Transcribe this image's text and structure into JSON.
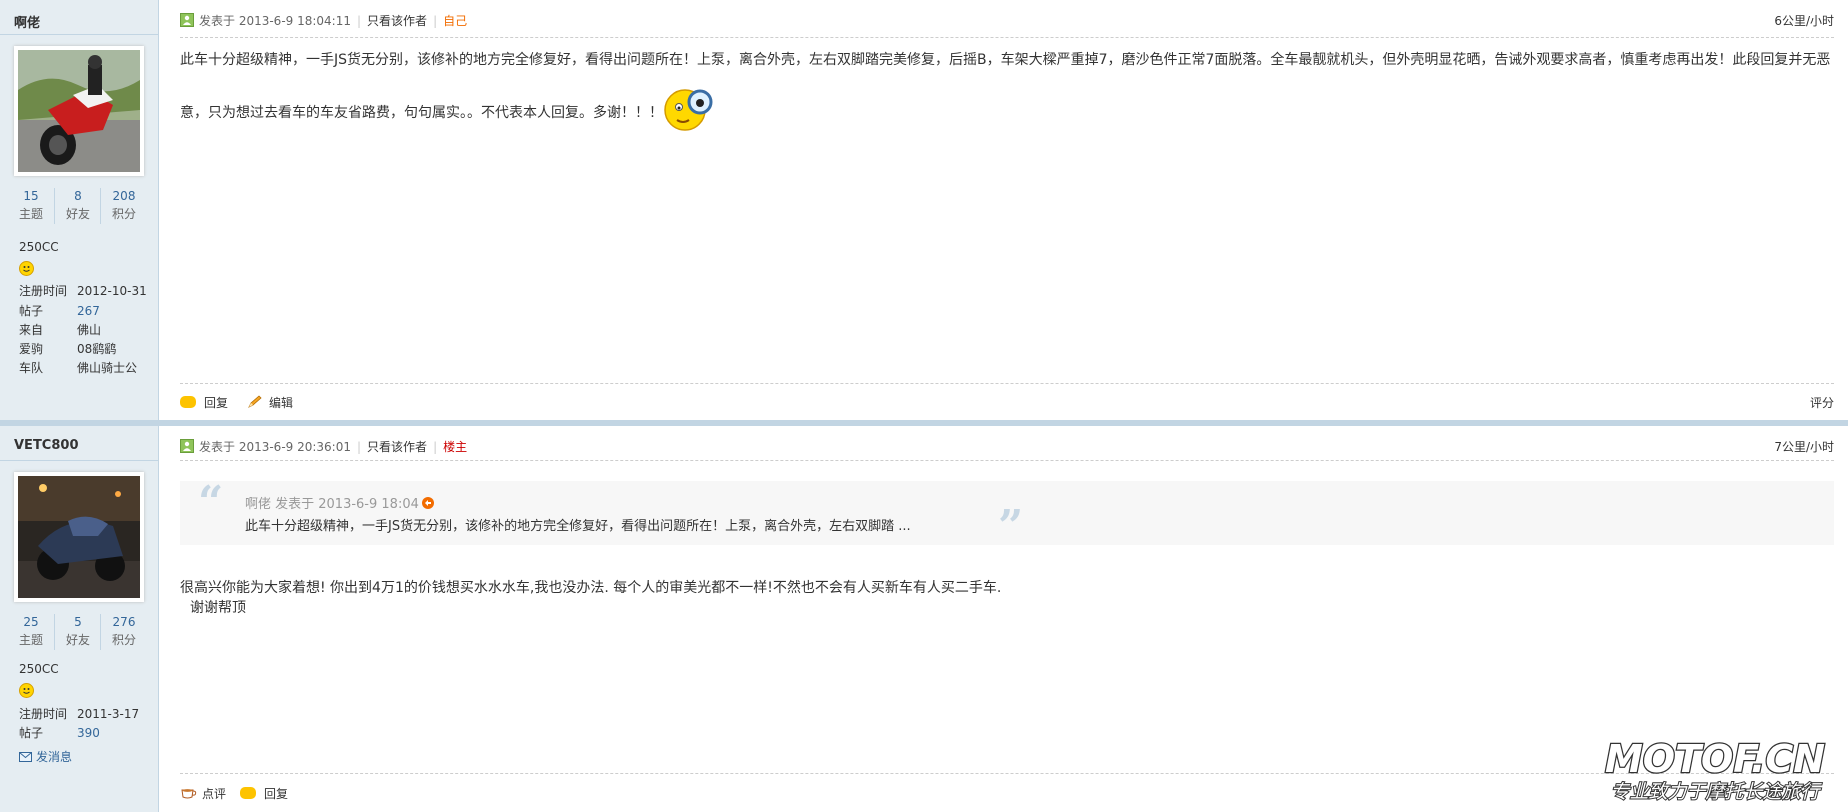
{
  "posts": [
    {
      "author": "啊佬",
      "stats": [
        {
          "num": "15",
          "label": "主题"
        },
        {
          "num": "8",
          "label": "好友"
        },
        {
          "num": "208",
          "label": "积分"
        }
      ],
      "level": "250CC",
      "profile": [
        {
          "key": "注册时间",
          "value": "2012-10-31"
        },
        {
          "key": "帖子",
          "value": "267"
        },
        {
          "key": "来自",
          "value": "佛山"
        },
        {
          "key": "爱驹",
          "value": "08鹞鹞"
        },
        {
          "key": "车队",
          "value": "佛山骑士公"
        }
      ],
      "posted": "发表于 2013-6-9 18:04:11",
      "only_author": "只看该作者",
      "tag": "自己",
      "floor": "6公里/小时",
      "body_line1": "此车十分超级精神，一手JS货无分别，该修补的地方完全修复好，看得出问题所在！上泵，离合外壳，左右双脚踏完美修复，后摇B，车架大樑严重掉7，磨沙色件正常7面脱落。全车最靓就机头，但外壳明显花晒，告诫外观要求高者，慎重考虑再出发！此段回复并无恶",
      "body_line2": "意，只为想过去看车的车友省路费，句句属实。。不代表本人回复。多谢！！！",
      "footer": {
        "reply": "回复",
        "edit": "编辑",
        "rate": "评分"
      }
    },
    {
      "author": "VETC800",
      "stats": [
        {
          "num": "25",
          "label": "主题"
        },
        {
          "num": "5",
          "label": "好友"
        },
        {
          "num": "276",
          "label": "积分"
        }
      ],
      "level": "250CC",
      "profile": [
        {
          "key": "注册时间",
          "value": "2011-3-17"
        },
        {
          "key": "帖子",
          "value": "390"
        }
      ],
      "send_message": "发消息",
      "posted": "发表于 2013-6-9 20:36:01",
      "only_author": "只看该作者",
      "tag": "楼主",
      "floor": "7公里/小时",
      "quote_meta": "啊佬 发表于 2013-6-9 18:04",
      "quote_body": "此车十分超级精神，一手JS货无分别，该修补的地方完全修复好，看得出问题所在！上泵，离合外壳，左右双脚踏 ...",
      "body_line1": "很高兴你能为大家着想! 你出到4万1的价钱想买水水水车,我也没办法. 每个人的审美光都不一样!不然也不会有人买新车有人买二手车.",
      "body_line2": "谢谢帮顶",
      "footer": {
        "comment": "点评",
        "reply": "回复"
      }
    }
  ],
  "watermark": {
    "brand": "MOTOF.CN",
    "slogan": "专业致力于摩托长途旅行"
  },
  "colors": {
    "link": "#336699",
    "sidebar": "#e5edf2",
    "border": "#c2d5e3",
    "self_tag": "#f26c00",
    "owner_tag": "#cc0000"
  }
}
